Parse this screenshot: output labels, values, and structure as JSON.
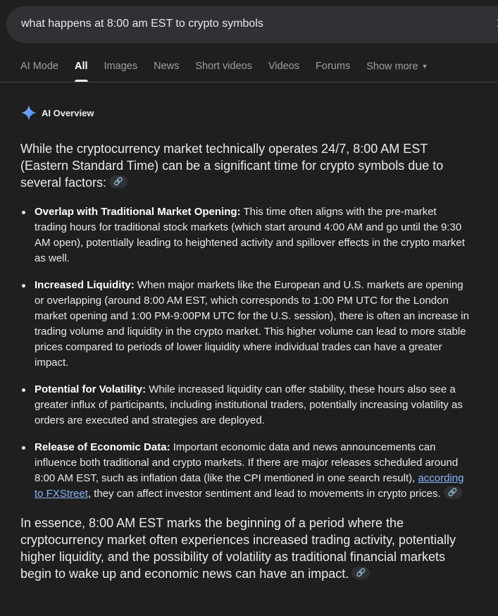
{
  "search": {
    "query": "what happens at 8:00 am EST to crypto symbols",
    "clear_icon": "close-icon"
  },
  "tabs": [
    {
      "label": "AI Mode"
    },
    {
      "label": "All"
    },
    {
      "label": "Images"
    },
    {
      "label": "News"
    },
    {
      "label": "Short videos"
    },
    {
      "label": "Videos"
    },
    {
      "label": "Forums"
    },
    {
      "label": "Show more"
    }
  ],
  "ai_overview": {
    "title": "AI Overview",
    "icon": "sparkle-icon",
    "lead": "While the cryptocurrency market technically operates 24/7, 8:00 AM EST (Eastern Standard Time) can be a significant time for crypto symbols due to several factors:",
    "bullets": [
      {
        "heading": "Overlap with Traditional Market Opening:",
        "text": " This time often aligns with the pre-market trading hours for traditional stock markets (which start around 4:00 AM and go until the 9:30 AM open), potentially leading to heightened activity and spillover effects in the crypto market as well."
      },
      {
        "heading": "Increased Liquidity:",
        "text": " When major markets like the European and U.S. markets are opening or overlapping (around 8:00 AM EST, which corresponds to 1:00 PM UTC for the London market opening and 1:00 PM-9:00PM UTC for the U.S. session), there is often an increase in trading volume and liquidity in the crypto market. This higher volume can lead to more stable prices compared to periods of lower liquidity where individual trades can have a greater impact."
      },
      {
        "heading": "Potential for Volatility:",
        "text": " While increased liquidity can offer stability, these hours also see a greater influx of participants, including institutional traders, potentially increasing volatility as orders are executed and strategies are deployed."
      },
      {
        "heading": "Release of Economic Data:",
        "text_before": " Important economic data and news announcements can influence both traditional and crypto markets. If there are major releases scheduled around 8:00 AM EST, such as inflation data (like the CPI mentioned in one search result), ",
        "link": "according to FXStreet",
        "text_after": ", they can affect investor sentiment and lead to movements in crypto prices."
      }
    ],
    "summary": "In essence, 8:00 AM EST marks the beginning of a period where the cryptocurrency market often experiences increased trading activity, potentially higher liquidity, and the possibility of volatility as traditional financial markets begin to wake up and economic news can have an impact.",
    "link_chip_icon": "link-icon"
  },
  "colors": {
    "background": "#1f1f1f",
    "search_bg": "#303134",
    "link": "#8ab4f8",
    "muted": "#9aa0a6"
  }
}
